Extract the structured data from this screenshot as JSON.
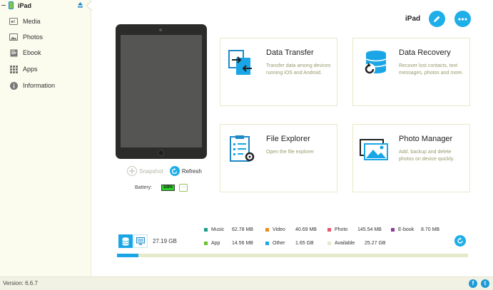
{
  "sidebar": {
    "device_name": "iPad",
    "items": [
      {
        "label": "Media",
        "icon": "media-icon"
      },
      {
        "label": "Photos",
        "icon": "photos-icon"
      },
      {
        "label": "Ebook",
        "icon": "ebook-icon"
      },
      {
        "label": "Apps",
        "icon": "apps-grid-icon"
      },
      {
        "label": "Information",
        "icon": "info-icon"
      }
    ]
  },
  "header": {
    "device_name": "iPad",
    "edit_icon": "pencil-icon",
    "more_icon": "more-dots-icon"
  },
  "device": {
    "snapshot_label": "Snapshot",
    "refresh_label": "Refresh",
    "battery_label": "Battery:",
    "battery_value": "100%",
    "battery_level": 1.0
  },
  "cards": [
    {
      "title": "Data Transfer",
      "description": "Transfer data among devices running iOS and Android.",
      "icon": "data-transfer-icon"
    },
    {
      "title": "Data Recovery",
      "description": "Recover lost contacts, text messages, photos and more.",
      "icon": "data-recovery-icon"
    },
    {
      "title": "File Explorer",
      "description": "Open the file explorer",
      "icon": "file-explorer-icon"
    },
    {
      "title": "Photo Manager",
      "description": "Add, backup and delete photos on device quickly.",
      "icon": "photo-manager-icon"
    }
  ],
  "storage": {
    "total": "27.19 GB",
    "used_fraction": 0.06,
    "legend": [
      {
        "label": "Music",
        "value": "62.78 MB",
        "color": "#1a9e8a"
      },
      {
        "label": "Video",
        "value": "40.69 MB",
        "color": "#f08a1c"
      },
      {
        "label": "Photo",
        "value": "145.54 MB",
        "color": "#e8566a"
      },
      {
        "label": "E-book",
        "value": "8.70 MB",
        "color": "#8a3e9a"
      },
      {
        "label": "App",
        "value": "14.56 MB",
        "color": "#6cc02e"
      },
      {
        "label": "Other",
        "value": "1.65 GB",
        "color": "#1aa6e6"
      },
      {
        "label": "Available",
        "value": "25.27 GB",
        "color": "#e4e9ca"
      }
    ]
  },
  "footer": {
    "version": "Version: 6.6.7",
    "facebook": "f",
    "twitter": "t"
  },
  "colors": {
    "accent": "#1eaee8",
    "sidebar_bg": "#fbfbee",
    "card_border": "#e9e8c8"
  }
}
